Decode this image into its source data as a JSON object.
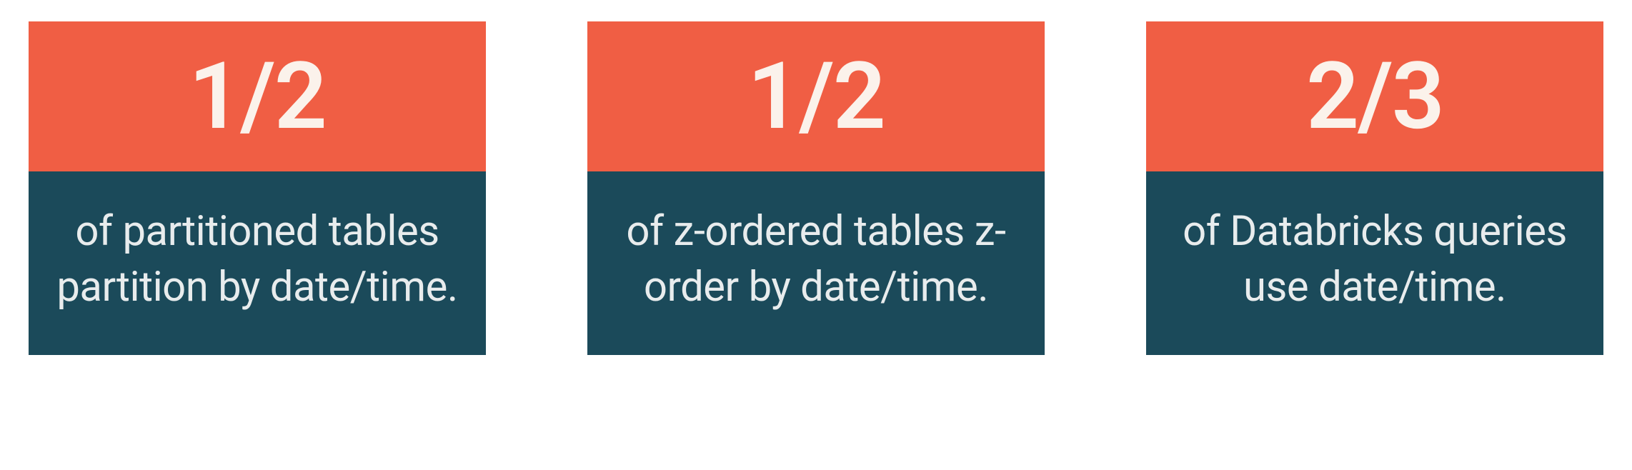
{
  "cards": [
    {
      "stat": "1/2",
      "description": "of partitioned tables partition by date/time."
    },
    {
      "stat": "1/2",
      "description": "of z-ordered tables z-order by date/time."
    },
    {
      "stat": "2/3",
      "description": "of Databricks queries use date/time."
    }
  ]
}
